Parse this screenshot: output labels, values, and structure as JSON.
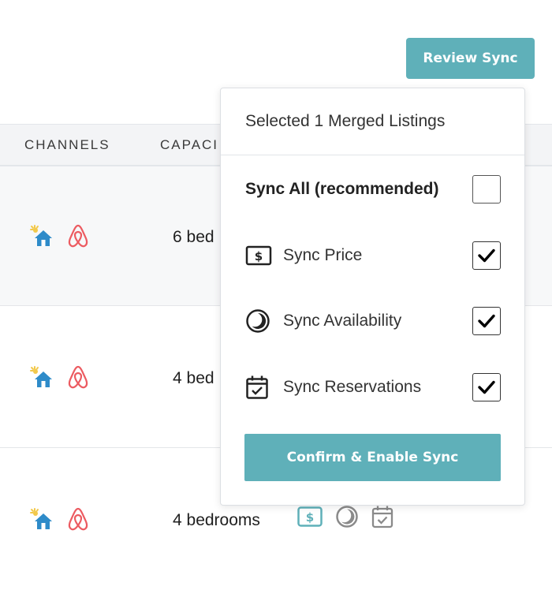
{
  "header": {
    "review_sync_label": "Review Sync"
  },
  "table": {
    "columns": [
      "CHANNELS",
      "CAPACI"
    ],
    "rows": [
      {
        "capacity": "6 bed"
      },
      {
        "capacity": "4 bed"
      },
      {
        "capacity": "4 bedrooms"
      }
    ]
  },
  "popover": {
    "title": "Selected 1 Merged Listings",
    "options": [
      {
        "label": "Sync All (recommended)",
        "checked": false,
        "icon": "none"
      },
      {
        "label": "Sync Price",
        "checked": true,
        "icon": "dollar-tag-icon"
      },
      {
        "label": "Sync Availability",
        "checked": true,
        "icon": "half-moon-icon"
      },
      {
        "label": "Sync Reservations",
        "checked": true,
        "icon": "calendar-check-icon"
      }
    ],
    "confirm_label": "Confirm & Enable Sync"
  },
  "colors": {
    "accent": "#5fb0b9",
    "airbnb": "#ec5b61",
    "home_blue": "#2e8bc9",
    "sun": "#f2c94c"
  }
}
